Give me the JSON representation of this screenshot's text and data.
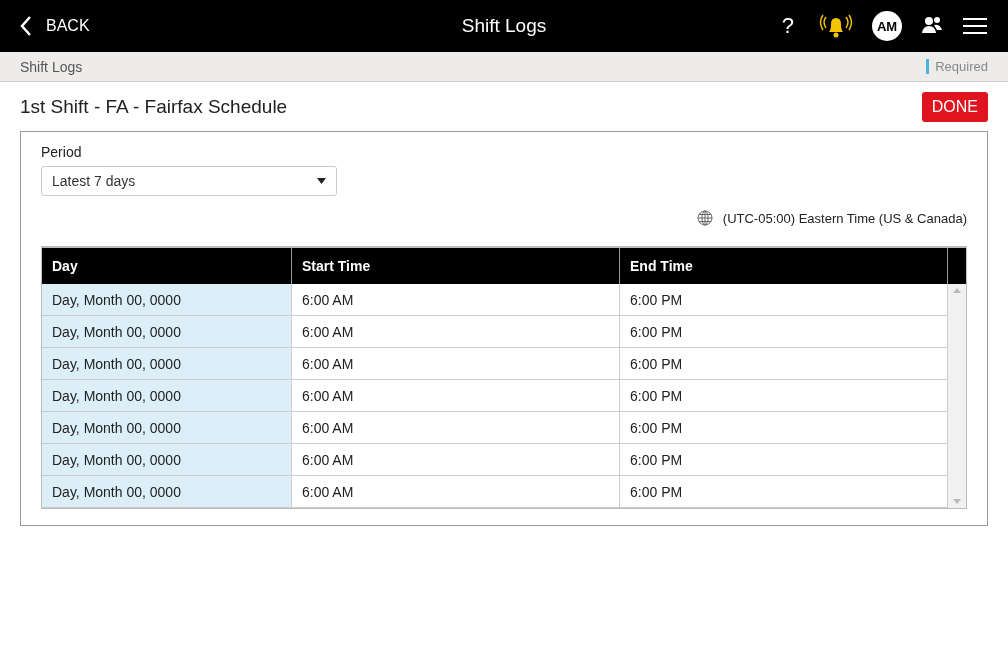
{
  "header": {
    "back": "BACK",
    "title": "Shift Logs",
    "help": "?",
    "avatar": "AM"
  },
  "breadcrumb": {
    "label": "Shift Logs",
    "required": "Required"
  },
  "page": {
    "title": "1st Shift - FA - Fairfax Schedule",
    "done": "DONE"
  },
  "period": {
    "label": "Period",
    "value": "Latest 7 days"
  },
  "timezone": "(UTC-05:00) Eastern Time (US & Canada)",
  "table": {
    "columns": [
      "Day",
      "Start Time",
      "End Time"
    ],
    "rows": [
      [
        "Day, Month 00, 0000",
        "6:00 AM",
        "6:00 PM"
      ],
      [
        "Day, Month 00, 0000",
        "6:00 AM",
        "6:00 PM"
      ],
      [
        "Day, Month 00, 0000",
        "6:00 AM",
        "6:00 PM"
      ],
      [
        "Day, Month 00, 0000",
        "6:00 AM",
        "6:00 PM"
      ],
      [
        "Day, Month 00, 0000",
        "6:00 AM",
        "6:00 PM"
      ],
      [
        "Day, Month 00, 0000",
        "6:00 AM",
        "6:00 PM"
      ],
      [
        "Day, Month 00, 0000",
        "6:00 AM",
        "6:00 PM"
      ]
    ]
  }
}
